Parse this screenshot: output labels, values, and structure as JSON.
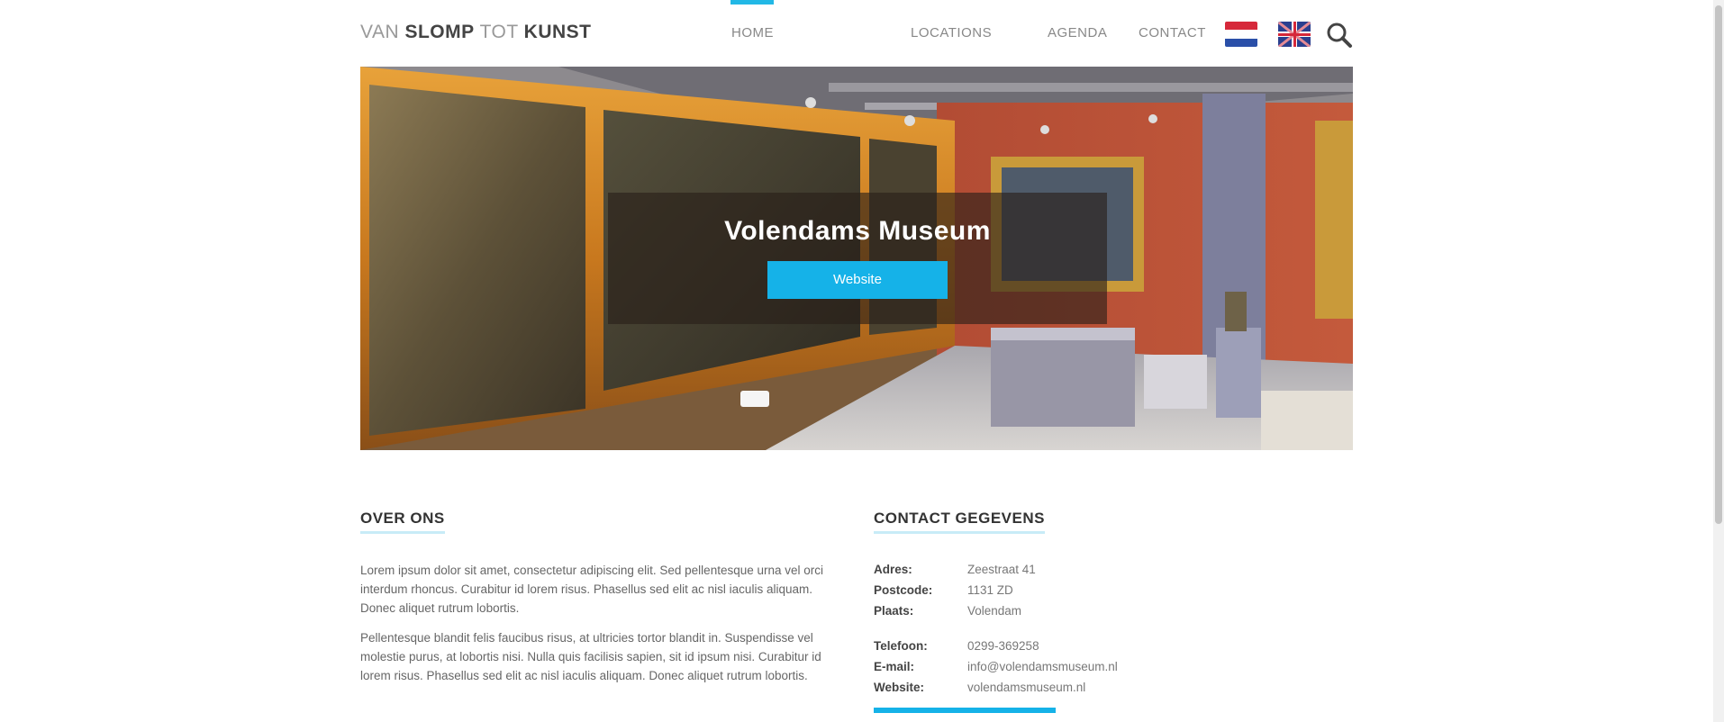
{
  "logo": {
    "part1": "VAN ",
    "part2": "SLOMP",
    "part3": " TOT ",
    "part4": "KUNST"
  },
  "nav": {
    "home": "HOME",
    "locaties": "LOCATIONS",
    "agenda": "AGENDA",
    "contact": "CONTACT"
  },
  "colors": {
    "accent": "#15b2e8",
    "nav_active": "#22b8e6"
  },
  "hero": {
    "title": "Volendams Museum",
    "button": "Website"
  },
  "over_ons": {
    "title": "OVER ONS",
    "para1": "Lorem ipsum dolor sit amet, consectetur adipiscing elit. Sed pellentesque urna vel orci interdum rhoncus. Curabitur id lorem risus. Phasellus sed elit ac nisl iaculis aliquam. Donec aliquet rutrum lobortis.",
    "para2": "Pellentesque blandit felis faucibus risus, at ultricies tortor blandit in. Suspendisse vel molestie purus, at lobortis nisi. Nulla quis facilisis sapien, sit id ipsum nisi. Curabitur id lorem risus. Phasellus sed elit ac nisl iaculis aliquam. Donec aliquet rutrum lobortis."
  },
  "contact": {
    "title": "CONTACT GEGEVENS",
    "rows1": [
      {
        "key": "Adres:",
        "value": "Zeestraat 41"
      },
      {
        "key": "Postcode:",
        "value": "1131 ZD"
      },
      {
        "key": "Plaats:",
        "value": "Volendam"
      }
    ],
    "rows2": [
      {
        "key": "Telefoon:",
        "value": "0299-369258"
      },
      {
        "key": "E-mail:",
        "value": "info@volendamsmuseum.nl"
      },
      {
        "key": "Website:",
        "value": "volendamsmuseum.nl"
      }
    ]
  }
}
